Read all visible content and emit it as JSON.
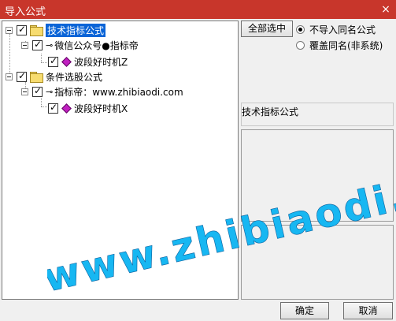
{
  "window": {
    "title": "导入公式",
    "close_glyph": "×"
  },
  "tree": {
    "nodes": [
      {
        "label": "技术指标公式",
        "selected": true
      },
      {
        "label": "微信公众号●指标帝"
      },
      {
        "label": "波段好时机Z"
      },
      {
        "label": "条件选股公式"
      },
      {
        "label": "指标帝：www.zhibiaodi.com"
      },
      {
        "label": "波段好时机X"
      }
    ]
  },
  "options": {
    "select_all": "全部选中",
    "radio_no_import": "不导入同名公式",
    "radio_overwrite": "覆盖同名(非系统)"
  },
  "info": {
    "category": "技术指标公式"
  },
  "buttons": {
    "ok": "确定",
    "cancel": "取消"
  },
  "watermark": {
    "text": "www.zhibiaodi.com"
  },
  "colors": {
    "titlebar": "#c8362b",
    "selection": "#0a64d7",
    "watermark": "#17b7f2",
    "gem": "#c020c0",
    "folder": "#f7dc6f"
  },
  "icons": [
    "folder-icon",
    "key-icon",
    "formula-gem-icon",
    "close-icon"
  ]
}
